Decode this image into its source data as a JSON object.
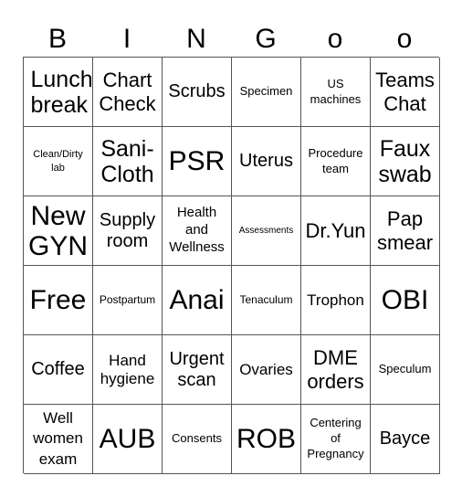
{
  "card": {
    "title_letters": [
      "B",
      "I",
      "N",
      "G",
      "o",
      "o"
    ],
    "cells": [
      [
        "Lunch break",
        "Chart Check",
        "Scrubs",
        "Specimen",
        "US machines",
        "Teams Chat"
      ],
      [
        "Clean/Dirty lab",
        "Sani-Cloth",
        "PSR",
        "Uterus",
        "Procedure team",
        "Faux swab"
      ],
      [
        "New GYN",
        "Supply room",
        "Health and Wellness",
        "Assessments",
        "Dr.Yun",
        "Pap smear"
      ],
      [
        "Free",
        "Postpartum",
        "Anai",
        "Tenaculum",
        "Trophon",
        "OBI"
      ],
      [
        "Coffee",
        "Hand hygiene",
        "Urgent scan",
        "Ovaries",
        "DME orders",
        "Speculum"
      ],
      [
        "Well women exam",
        "AUB",
        "Consents",
        "ROB",
        "Centering of Pregnancy",
        "Bayce"
      ]
    ]
  }
}
